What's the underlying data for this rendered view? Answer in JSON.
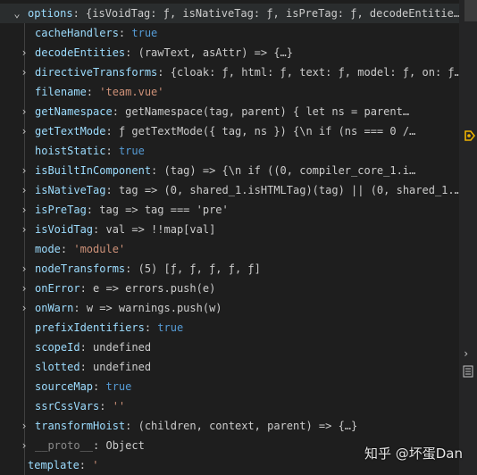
{
  "colors": {
    "background": "#1e1e1e",
    "key": "#9cdcfe",
    "boolean": "#569cd6",
    "string": "#ce9178",
    "text": "#cccccc",
    "breakpoint": "#f0b400"
  },
  "root": {
    "key": "options",
    "value": "{isVoidTag: ƒ, isNativeTag: ƒ, isPreTag: ƒ, decodeEntitie…"
  },
  "properties": [
    {
      "key": "cacheHandlers",
      "value": "true",
      "type": "bool",
      "expandable": false
    },
    {
      "key": "decodeEntities",
      "value": "(rawText, asAttr) => {…}",
      "type": "fn",
      "expandable": true
    },
    {
      "key": "directiveTransforms",
      "value": "{cloak: ƒ, html: ƒ, text: ƒ, model: ƒ, on: ƒ…",
      "type": "fn",
      "expandable": true
    },
    {
      "key": "filename",
      "value": "'team.vue'",
      "type": "str",
      "expandable": false
    },
    {
      "key": "getNamespace",
      "value": "getNamespace(tag, parent) {          let ns = parent…",
      "type": "fn",
      "expandable": true
    },
    {
      "key": "getTextMode",
      "value": "ƒ getTextMode({ tag, ns }) {\\n        if (ns === 0 /…",
      "type": "fn",
      "expandable": true
    },
    {
      "key": "hoistStatic",
      "value": "true",
      "type": "bool",
      "expandable": false
    },
    {
      "key": "isBuiltInComponent",
      "value": "(tag) => {\\n        if ((0, compiler_core_1.i…",
      "type": "fn",
      "expandable": true
    },
    {
      "key": "isNativeTag",
      "value": "tag => (0, shared_1.isHTMLTag)(tag) || (0, shared_1.…",
      "type": "fn",
      "expandable": true
    },
    {
      "key": "isPreTag",
      "value": "tag => tag === 'pre'",
      "type": "fn",
      "expandable": true
    },
    {
      "key": "isVoidTag",
      "value": "val => !!map[val]",
      "type": "fn",
      "expandable": true
    },
    {
      "key": "mode",
      "value": "'module'",
      "type": "str",
      "expandable": false
    },
    {
      "key": "nodeTransforms",
      "value": "(5) [ƒ, ƒ, ƒ, ƒ, ƒ]",
      "type": "fn",
      "expandable": true
    },
    {
      "key": "onError",
      "value": "e => errors.push(e)",
      "type": "fn",
      "expandable": true
    },
    {
      "key": "onWarn",
      "value": "w => warnings.push(w)",
      "type": "fn",
      "expandable": true
    },
    {
      "key": "prefixIdentifiers",
      "value": "true",
      "type": "bool",
      "expandable": false
    },
    {
      "key": "scopeId",
      "value": "undefined",
      "type": "fn",
      "expandable": false
    },
    {
      "key": "slotted",
      "value": "undefined",
      "type": "fn",
      "expandable": false
    },
    {
      "key": "sourceMap",
      "value": "true",
      "type": "bool",
      "expandable": false
    },
    {
      "key": "ssrCssVars",
      "value": "''",
      "type": "str",
      "expandable": false
    },
    {
      "key": "transformHoist",
      "value": "(children, context, parent) => {…}",
      "type": "fn",
      "expandable": true
    },
    {
      "key": "__proto__",
      "value": "Object",
      "type": "fn",
      "expandable": true,
      "dim": true
    }
  ],
  "trailing": {
    "key": "template",
    "value": "'"
  },
  "watermark": "知乎 @坏蛋Dan",
  "icons": {
    "expanded": "chevron-down-icon",
    "collapsed": "chevron-right-icon",
    "breakpoint": "breakpoint-arrow-icon",
    "side_expand": "chevron-right-icon",
    "side_document": "document-icon"
  }
}
